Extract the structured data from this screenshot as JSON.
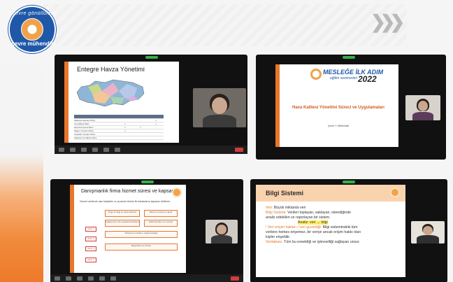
{
  "logo": {
    "top_text": "çevre gönüllüleri",
    "bottom_text": "çevre mühendisi"
  },
  "colors": {
    "accent": "#e8762b",
    "brand": "#1f58a8",
    "zoom_bg": "#111111"
  },
  "decor": {
    "chevrons": "❯❯❯"
  },
  "tiles": [
    {
      "slide_title": "Entegre Havza Yönetimi",
      "table_rows": [
        {
          "label": "Sakarya Havzası Planı",
          "cols": [
            "",
            "",
            "x"
          ]
        },
        {
          "label": "Su Kalitesi Planı",
          "cols": [
            "x",
            "",
            "x"
          ]
        },
        {
          "label": "Havza Koruma Planı",
          "cols": [
            "x",
            "x",
            ""
          ]
        },
        {
          "label": "Taşkın Yönetim Planı",
          "cols": [
            "x",
            "",
            ""
          ]
        },
        {
          "label": "Kuraklık Yönetim Planı",
          "cols": [
            "",
            "",
            ""
          ]
        },
        {
          "label": "Sektörel Su Tahsis Planı",
          "cols": [
            "",
            "",
            ""
          ]
        }
      ]
    },
    {
      "brand_title": "MESLEĞE İLK ADIM",
      "brand_sub": "eğitim seminerleri",
      "year": "2022",
      "talk_title": "Hava Kalitesi Yönetimi Süreci ve Uygulamaları",
      "speaker": "Çevre Y. Mühendisi"
    },
    {
      "slide_title": "Danışmanlık firma hizmet süresi ve kapsamı",
      "intro": "Hizmet verilecek olan faaliyetin ve prosesin türüne ilk bakılarak iş kapsamı belirlenir.",
      "boxes": [
        "Proje ön bilgi ve istek belirlenir",
        "Saha ön inceleme yapılır",
        "Faaliyet için izin prosedürü belirlenir",
        "Teklif hazırlanır ve sunulur",
        "Sözleşme imzalanır, çalışma başlar",
        "Raporlama ve izleme"
      ],
      "tags": [
        "Adım 1",
        "Adım 2",
        "Adım 3",
        "Adım 4"
      ]
    },
    {
      "slide_title": "Bilgi Sistemi",
      "lines": [
        {
          "k": "Veri:",
          "t": " Büyük miktarda veri"
        },
        {
          "k": "Bilgi Sistemi:",
          "t": " Verileri toplayan, saklayan, istendiğinde"
        },
        {
          "k": "",
          "t": "analiz edebilen ve raporlayan bir sistem."
        },
        {
          "k": "",
          "t": "Analiz: veri → bilgi",
          "hl": true
        },
        {
          "k": "! Veri erişim hakları / veri güvenliği:",
          "t": " Bilgi sistemindeki tüm"
        },
        {
          "k": "",
          "t": "verilere herkes erişemez, bir veriye ancak erişim hakkı olan"
        },
        {
          "k": "",
          "t": "kişiler erişebilir."
        },
        {
          "k": "Veritabanı:",
          "t": " Tüm bu esnekliği ve işlevselliği sağlayan unsur."
        }
      ]
    }
  ]
}
